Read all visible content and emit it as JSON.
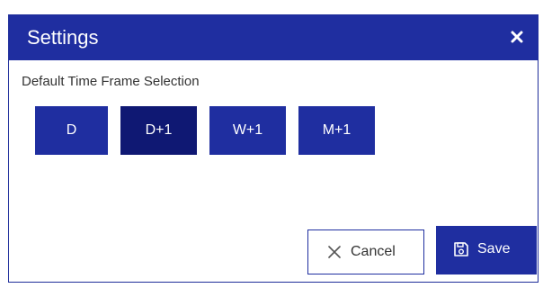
{
  "dialog": {
    "title": "Settings",
    "close_icon": "close-icon"
  },
  "settings": {
    "section_label": "Default Time Frame Selection",
    "time_frames": [
      {
        "label": "D",
        "selected": false
      },
      {
        "label": "D+1",
        "selected": true
      },
      {
        "label": "W+1",
        "selected": false
      },
      {
        "label": "M+1",
        "selected": false
      }
    ]
  },
  "actions": {
    "cancel_label": "Cancel",
    "cancel_icon": "x-icon",
    "save_label": "Save",
    "save_icon": "floppy-disk-icon"
  },
  "colors": {
    "primary": "#1f2ea0",
    "selected": "#0f1873",
    "text": "#333333"
  }
}
